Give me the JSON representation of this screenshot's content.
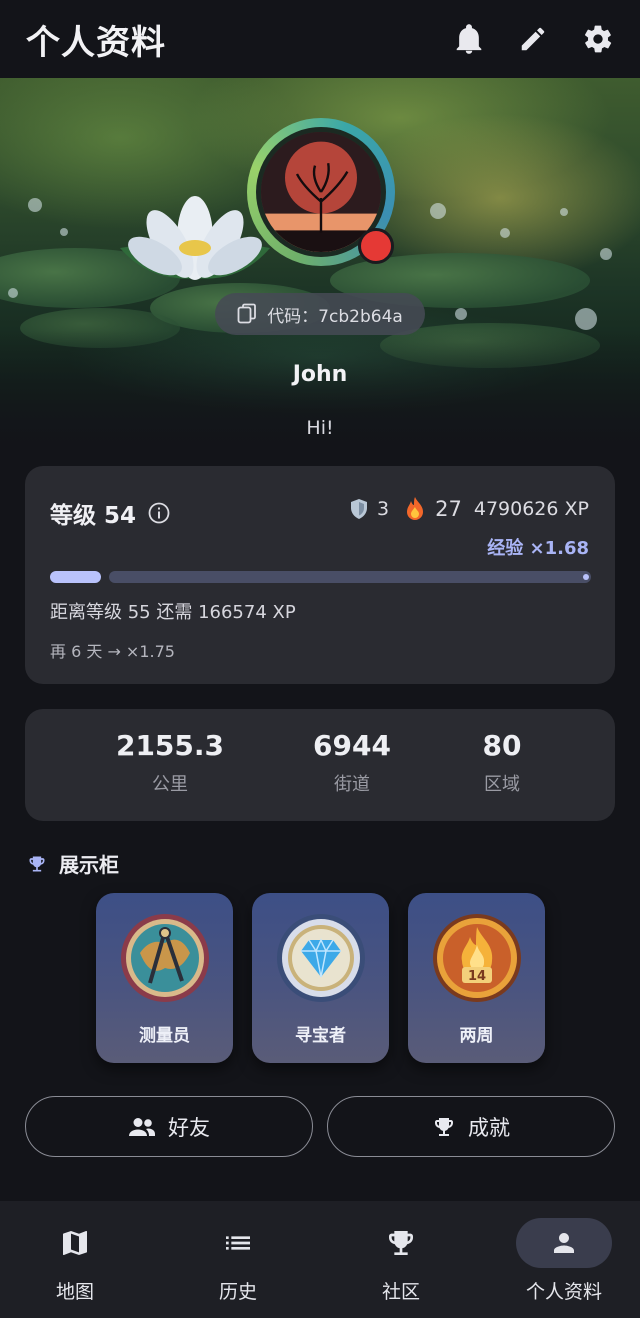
{
  "appbar": {
    "title": "个人资料",
    "icons": [
      "bell-icon",
      "edit-icon",
      "settings-icon"
    ]
  },
  "profile": {
    "code_label": "代码：7cb2b64a",
    "name": "John",
    "bio": "Hi!",
    "status_color": "#e53935"
  },
  "level": {
    "title": "等级 54",
    "shield_count": "3",
    "streak": "27",
    "total_xp": "4790626 XP",
    "xp_multiplier": "经验 ×1.68",
    "progress_fraction": 0.1,
    "next_level_text": "距离等级 55 还需 166574 XP",
    "boost_hint": "再 6 天 → ×1.75"
  },
  "stats": [
    {
      "value": "2155.3",
      "label": "公里"
    },
    {
      "value": "6944",
      "label": "街道"
    },
    {
      "value": "80",
      "label": "区域"
    }
  ],
  "showcase": {
    "title": "展示柜",
    "badges": [
      {
        "label": "测量员",
        "icon": "compass-icon"
      },
      {
        "label": "寻宝者",
        "icon": "diamond-icon"
      },
      {
        "label": "两周",
        "icon": "flame-icon",
        "number": "14"
      }
    ]
  },
  "buttons": {
    "friends": "好友",
    "achievements": "成就"
  },
  "nav": [
    {
      "label": "地图",
      "icon": "map-icon"
    },
    {
      "label": "历史",
      "icon": "list-icon"
    },
    {
      "label": "社区",
      "icon": "trophy-icon"
    },
    {
      "label": "个人资料",
      "icon": "person-icon",
      "active": true
    }
  ],
  "colors": {
    "accent": "#a9b4f5",
    "background": "#131419",
    "card": "#2a2b31"
  }
}
